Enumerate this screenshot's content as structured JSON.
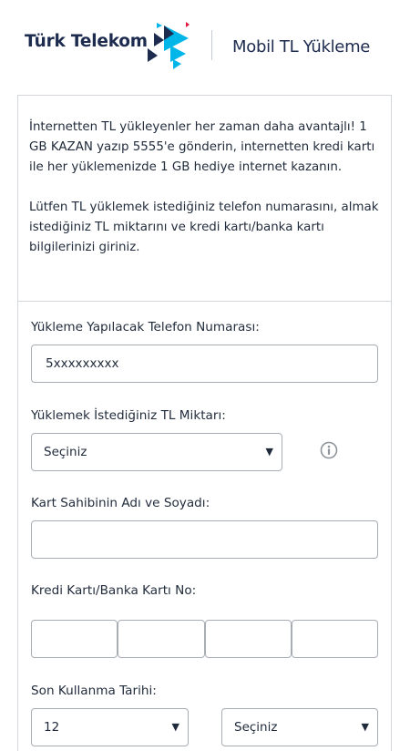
{
  "header": {
    "brand": "Türk Telekom",
    "subtitle": "Mobil TL Yükleme"
  },
  "intro": {
    "paragraph1": "İnternetten TL yükleyenler her zaman daha avantajlı! 1 GB KAZAN yazıp 5555'e gönderin, internetten kredi kartı ile her yüklemenizde 1 GB hediye internet kazanın.",
    "paragraph2": "Lütfen TL yüklemek istediğiniz telefon numarasını, almak istediğiniz TL miktarını ve kredi kartı/banka kartı bilgilerinizi giriniz."
  },
  "form": {
    "phone_label": "Yükleme Yapılacak Telefon Numarası:",
    "phone_value": "5xxxxxxxxx",
    "amount_label": "Yüklemek İstediğiniz TL Miktarı:",
    "amount_value": "Seçiniz",
    "holder_label": "Kart Sahibinin Adı ve Soyadı:",
    "holder_value": "",
    "card_label": "Kredi Kartı/Banka Kartı No:",
    "card_parts": [
      "",
      "",
      "",
      ""
    ],
    "expiry_label": "Son Kullanma Tarihi:",
    "expiry_month": "12",
    "expiry_year": "Seçiniz"
  },
  "icons": {
    "info": "info-icon",
    "dropdown": "chevron-down-icon"
  },
  "colors": {
    "brand_navy": "#1d2b4f",
    "accent_cyan": "#00b6e8",
    "accent_red": "#e5173f",
    "border": "#a8adb4"
  }
}
